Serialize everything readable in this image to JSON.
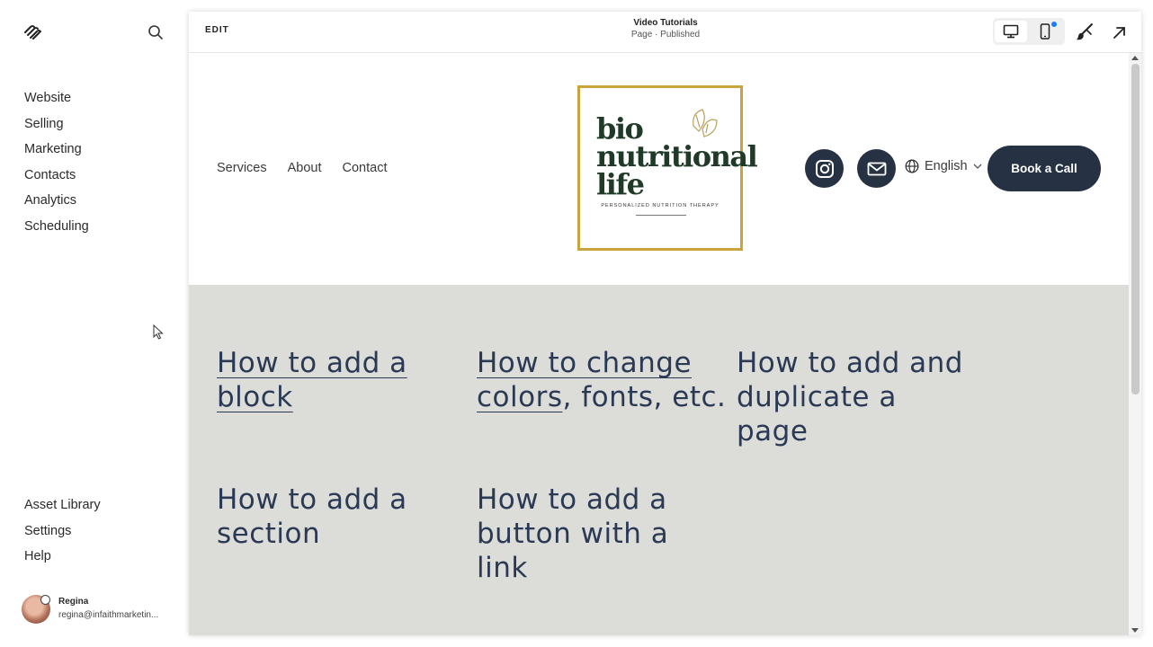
{
  "sidebar": {
    "main_items": [
      {
        "label": "Website"
      },
      {
        "label": "Selling"
      },
      {
        "label": "Marketing"
      },
      {
        "label": "Contacts"
      },
      {
        "label": "Analytics"
      },
      {
        "label": "Scheduling"
      }
    ],
    "bottom_items": [
      {
        "label": "Asset Library"
      },
      {
        "label": "Settings"
      },
      {
        "label": "Help"
      }
    ],
    "user": {
      "name": "Regina",
      "email": "regina@infaithmarketin..."
    }
  },
  "topbar": {
    "edit_label": "EDIT",
    "page_title": "Video Tutorials",
    "page_status": "Page · Published"
  },
  "site": {
    "nav": [
      "Services",
      "About",
      "Contact"
    ],
    "brand": {
      "lines": [
        "bio",
        "nutritional",
        "life"
      ],
      "tagline": "PERSONALIZED NUTRITION THERAPY"
    },
    "language": "English",
    "cta": "Book a Call",
    "accent_color": "#263244",
    "section_bg": "#dcdcd8"
  },
  "tutorials": [
    {
      "line1": "How to add a",
      "line2": "block",
      "line3": ""
    },
    {
      "line1": "How to change",
      "line2": "colors",
      "line2_tail": ", fonts, etc.",
      "line3": ""
    },
    {
      "line1": "How to add and",
      "line2": "duplicate a",
      "line3": "page"
    },
    {
      "line1": "How to add a",
      "line2": "section",
      "line3": ""
    },
    {
      "line1": "How to add a",
      "line2": "button with a",
      "line3": "link"
    }
  ]
}
